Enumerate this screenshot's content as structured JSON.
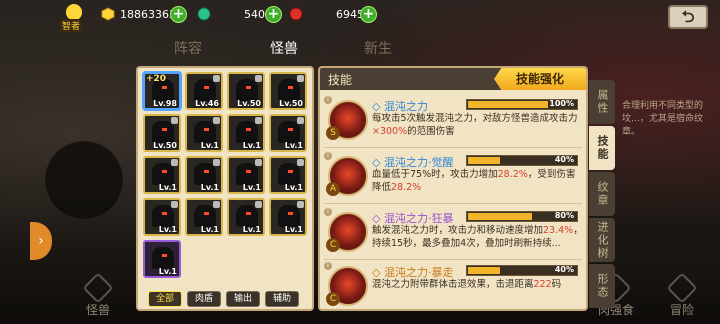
{
  "topbar": {
    "smart_label": "智者",
    "gold": "188633637",
    "green_currency": "540",
    "red_currency": "6945",
    "plus": "+",
    "back": "⮌"
  },
  "tabs": {
    "lineup": "阵容",
    "monster": "怪兽",
    "newborn": "新生"
  },
  "monsters": [
    {
      "level": "Lv.98",
      "plus": "+20",
      "selected": true
    },
    {
      "level": "Lv.46"
    },
    {
      "level": "Lv.50"
    },
    {
      "level": "Lv.50"
    },
    {
      "level": "Lv.50"
    },
    {
      "level": "Lv.1"
    },
    {
      "level": "Lv.1"
    },
    {
      "level": "Lv.1"
    },
    {
      "level": "Lv.1"
    },
    {
      "level": "Lv.1"
    },
    {
      "level": "Lv.1"
    },
    {
      "level": "Lv.1"
    },
    {
      "level": "Lv.1"
    },
    {
      "level": "Lv.1"
    },
    {
      "level": "Lv.1"
    },
    {
      "level": "Lv.1"
    },
    {
      "level": "Lv.1"
    }
  ],
  "filters": [
    "全部",
    "肉盾",
    "输出",
    "辅助"
  ],
  "skills": {
    "header": "技能",
    "enhance_button": "技能强化",
    "items": [
      {
        "name": "混沌之力",
        "badge": "S",
        "percent": "100%",
        "progress": 1.0,
        "desc_a": "每攻击5次触发混沌之力，对敌方怪兽造成攻击力",
        "desc_hl": "×300%",
        "desc_b": "的范围伤害"
      },
      {
        "name": "混沌之力·觉醒",
        "badge": "A",
        "percent": "40%",
        "progress": 0.4,
        "desc_a": "血量低于75%时，攻击力增加",
        "desc_hl": "28.2%",
        "desc_b": "，受到伤害降低",
        "desc_hl2": "28.2%"
      },
      {
        "name": "混沌之力·狂暴",
        "badge": "C",
        "percent": "80%",
        "progress": 0.8,
        "desc_a": "触发混沌之力时，攻击力和移动速度增加",
        "desc_hl": "23.4%",
        "desc_b": "，持续15秒，最多叠加4次，叠加时刷新持续..."
      },
      {
        "name": "混沌之力·暴走",
        "badge": "C",
        "percent": "40%",
        "progress": 0.4,
        "desc_a": "混沌之力附带群体击退效果，击退距离",
        "desc_hl": "222",
        "desc_b": "码"
      }
    ]
  },
  "side_tabs": [
    "属性",
    "技能",
    "纹章",
    "进化树",
    "形态"
  ],
  "right_hint": "合理利用不同类型的坟…，尤其是宿命纹章。",
  "bottom_nav": [
    "怪兽",
    "肉强食",
    "冒险"
  ]
}
